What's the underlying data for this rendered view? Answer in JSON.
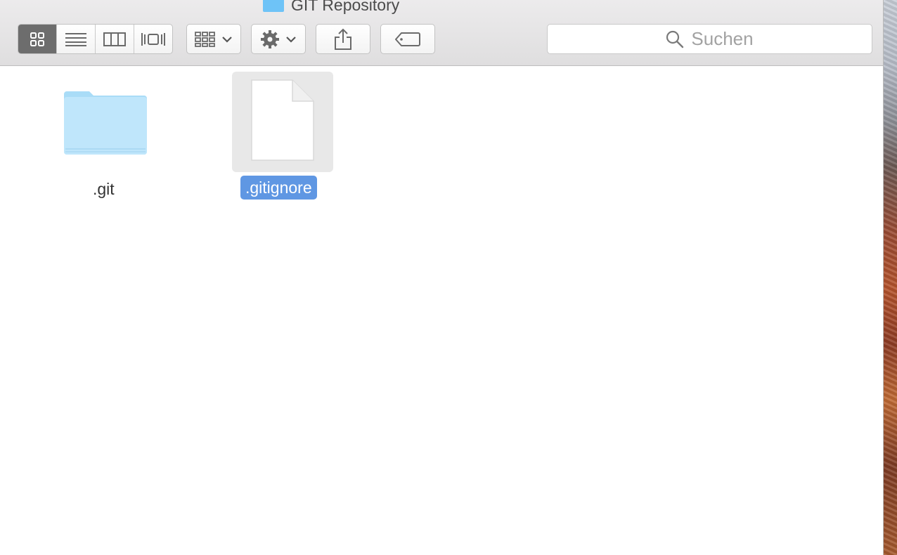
{
  "window": {
    "title": "GIT Repository",
    "accent_color": "#5f97e3"
  },
  "toolbar": {
    "view_modes": [
      {
        "name": "icon-view",
        "icon": "grid-icon",
        "active": true
      },
      {
        "name": "list-view",
        "icon": "list-icon",
        "active": false
      },
      {
        "name": "column-view",
        "icon": "columns-icon",
        "active": false
      },
      {
        "name": "gallery-view",
        "icon": "cover-flow-icon",
        "active": false
      }
    ],
    "arrange_icon": "arrange-grid-icon",
    "action_icon": "gear-icon",
    "share_icon": "share-icon",
    "tag_icon": "tag-icon",
    "search": {
      "placeholder": "Suchen"
    }
  },
  "files": [
    {
      "name": ".git",
      "kind": "folder",
      "selected": false
    },
    {
      "name": ".gitignore",
      "kind": "document",
      "selected": true
    }
  ]
}
